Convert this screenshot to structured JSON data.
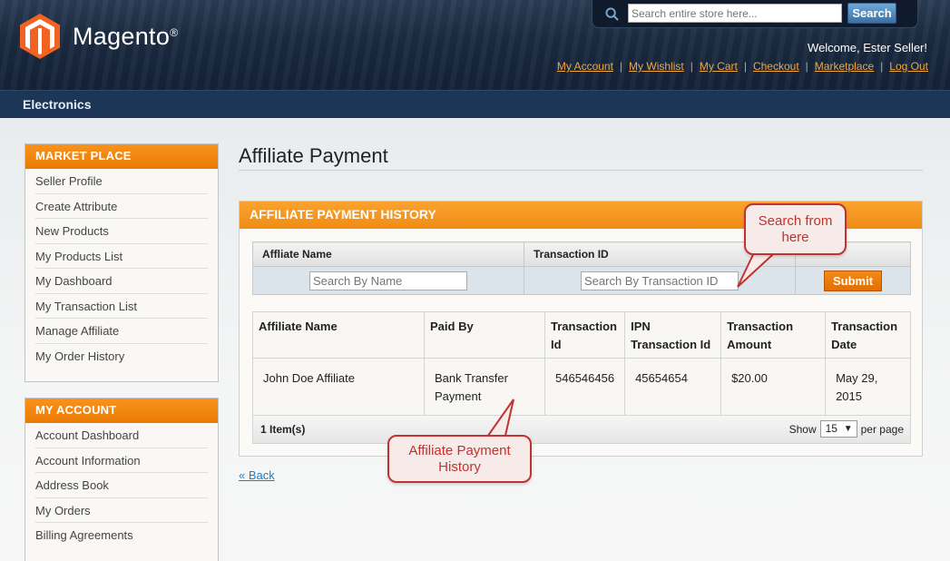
{
  "header": {
    "brand": "Magento",
    "brand_mark": "®",
    "search_placeholder": "Search entire store here...",
    "search_button": "Search",
    "welcome": "Welcome, Ester Seller!",
    "links": [
      "My Account",
      "My Wishlist",
      "My Cart",
      "Checkout",
      "Marketplace",
      "Log Out"
    ]
  },
  "nav": {
    "category": "Electronics"
  },
  "sidebar": {
    "marketplace": {
      "title": "MARKET PLACE",
      "items": [
        "Seller Profile",
        "Create Attribute",
        "New Products",
        "My Products List",
        "My Dashboard",
        "My Transaction List",
        "Manage Affiliate",
        "My Order History"
      ]
    },
    "account": {
      "title": "MY ACCOUNT",
      "items": [
        "Account Dashboard",
        "Account Information",
        "Address Book",
        "My Orders",
        "Billing Agreements"
      ]
    }
  },
  "main": {
    "page_title": "Affiliate Payment",
    "box_title": "AFFILIATE PAYMENT HISTORY",
    "filter": {
      "name_header": "Affliate Name",
      "transaction_header": "Transaction ID",
      "name_placeholder": "Search By Name",
      "transaction_placeholder": "Search By Transaction ID",
      "submit": "Submit"
    },
    "table": {
      "headers": [
        "Affiliate Name",
        "Paid By",
        "Transaction Id",
        "IPN Transaction Id",
        "Transaction Amount",
        "Transaction Date"
      ],
      "rows": [
        [
          "John Doe Affiliate",
          "Bank Transfer Payment",
          "546546456",
          "45654654",
          "$20.00",
          "May 29, 2015"
        ]
      ]
    },
    "pager": {
      "items": "1 Item(s)",
      "show_label": "Show",
      "limit": "15",
      "per_page": "per page"
    },
    "back": "« Back"
  },
  "callouts": {
    "search": "Search from here",
    "history": "Affiliate Payment History"
  },
  "colors": {
    "accent_orange": "#f18200",
    "header_navy": "#1c2c42",
    "link_orange": "#f0a73c",
    "callout_red": "#c2322e"
  }
}
